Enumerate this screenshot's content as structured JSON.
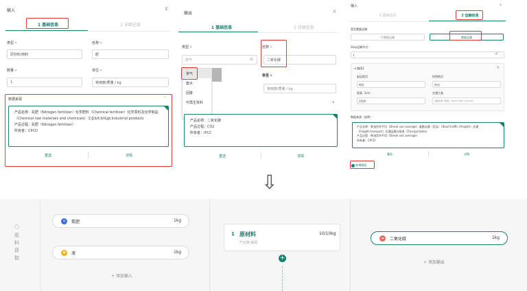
{
  "input_panel": {
    "title": "输入",
    "close": "X",
    "tabs": [
      {
        "num": "1",
        "label": "基础信息"
      },
      {
        "num": "2",
        "label": "详细记录"
      }
    ],
    "type_label": "类型",
    "type_value": "原材料/物料",
    "name_label": "名称",
    "name_value": "肥",
    "qty_label": "数量",
    "qty_value": "1",
    "unit_label": "单位",
    "unit_value": "常用数/质量 / kg",
    "source_label": "数据来源",
    "card_line1": "产品名称：氮肥（Nitrogen fertilizer）化学肥料（Chemical fertilizer）化学原料及化学制品",
    "card_line2": "（Chemical raw materials and chemicals）工业&lt;br&gt;Industrial products",
    "card_line3": "产品过程：氮肥（Nitrogen fertilizer）",
    "card_line4": "所有者：CPCD",
    "btn_left": "重选",
    "btn_right": "详情"
  },
  "output_panel": {
    "title": "输出",
    "close": "X",
    "tabs": [
      {
        "num": "1",
        "label": "基础信息"
      },
      {
        "num": "2",
        "label": "详细信息"
      }
    ],
    "type_label": "类型",
    "type_placeholder": "排气",
    "name_label": "名称",
    "name_value": "二氧化碳",
    "qty_label": "数量",
    "unit_label": "单位",
    "unit_value": "常用数/质量 / kg",
    "dropdown": [
      "排气",
      "废水",
      "固废",
      "可再生资料"
    ],
    "card_line1": "产品名称：二氧化碳",
    "card_line2": "产品过程：CO2",
    "card_line3": "所有者：IPCC",
    "btn_left": "重选",
    "btn_right": "详情"
  },
  "right_panel": {
    "title": "输入",
    "close": "×",
    "tabs": [
      {
        "num": "1",
        "label": "基础信息"
      },
      {
        "num": "2",
        "label": "运输信息"
      }
    ],
    "q1": "是否需要运输：",
    "opt_no": "不需要运输",
    "opt_yes": "需要运输",
    "route_label": "Step运输节点：",
    "route_value": "1",
    "group_title": "路段1",
    "f1": "起运地点",
    "v1": "地址",
    "f2": "终到地点",
    "v2": "终点",
    "f3": "距离（km）",
    "v3": "2000",
    "f4": "交通工具",
    "v4": "道路交通（货运）（Road traffic (freight)）",
    "src_label": "数据来源（选择）：",
    "c1": "产品名称：柴油货车平均（Diesel van average）道路交通（货运）（Road traffic (freight)）交通",
    "c2": "（Freight transport）交通运输与物流（Transportation",
    "c3": "产品过程：柴油货车平均（Diesel van average）",
    "c4": "所有者：CPCD",
    "btn_left": "重选",
    "btn_right": "详情",
    "add_route": "新增路段"
  },
  "arrow": "⇩",
  "flow": {
    "side_label": "原料获取",
    "inputs": [
      {
        "name": "氮肥",
        "amount": "1kg",
        "color": "#3d6fd9"
      },
      {
        "name": "液",
        "amount": "1kg",
        "color": "#f2b01e"
      }
    ],
    "add_input": "+ 添加输入",
    "process": {
      "num": "1",
      "title": "原材料",
      "subtitle": "产出物 解码",
      "amount": "10/10kg"
    },
    "output": {
      "name": "二氧化碳",
      "amount": "1kg",
      "color": "#e86a5a"
    },
    "add_output": "+ 添加输出"
  },
  "colors": {
    "accent": "#19806f",
    "highlight": "#e23a3a"
  }
}
